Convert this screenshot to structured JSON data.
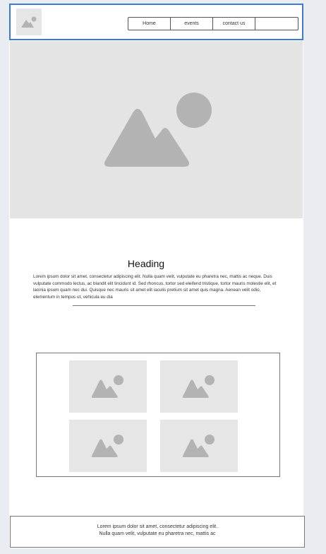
{
  "nav": {
    "items": [
      {
        "label": "Home"
      },
      {
        "label": "events"
      },
      {
        "label": "contact us"
      },
      {
        "label": ""
      }
    ]
  },
  "content": {
    "heading": "Heading",
    "body": "Lorem ipsum dolor sit amet, consectetur adipiscing elit. Nulla quam velit, vulputate eu pharetra nec, mattis ac neque. Duis vulputate commodo lectus, ac blandit elit tincidunt id. Sed rhoncus, tortor sed eleifend tristique, tortor mauris molestie elit, et lacinia ipsum quam nec dui. Quisque nec mauris sit amet elit iaculis pretium sit amet quis magna. Aenean velit odio, elementum in tempus ut, vehicula eu dia"
  },
  "gallery": {
    "item_count": 4
  },
  "footer": {
    "line1": "Lorem ipsum dolor sit amet, consectetur adipiscing elit.",
    "line2": "Nulla quam velit, vulputate eu pharetra nec, mattis ac"
  },
  "colors": {
    "header_border": "#3a7bd5",
    "placeholder_bg": "#e4e4e4",
    "placeholder_icon": "#b3b3b3"
  },
  "icons": {
    "placeholder": "image-placeholder-icon"
  }
}
